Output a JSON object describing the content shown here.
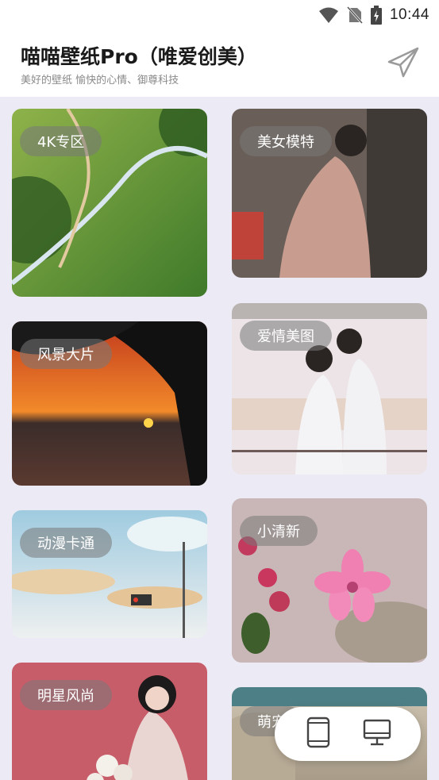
{
  "status_bar": {
    "time": "10:44",
    "icons": [
      "wifi-icon",
      "no-sim-icon",
      "battery-charging-icon"
    ]
  },
  "header": {
    "title": "喵喵壁纸Pro（唯爱创美）",
    "subtitle": "美好的壁纸 愉快的心情、御尊科技",
    "share_icon": "paper-plane-icon"
  },
  "categories": [
    {
      "label": "4K专区"
    },
    {
      "label": "美女模特"
    },
    {
      "label": "风景大片"
    },
    {
      "label": "爱情美图"
    },
    {
      "label": "动漫卡通"
    },
    {
      "label": "小清新"
    },
    {
      "label": "明星风尚"
    },
    {
      "label": "萌宠"
    }
  ],
  "switcher": {
    "items": [
      "phone-icon",
      "desktop-monitor-icon"
    ]
  },
  "colors": {
    "background": "#ecebf5",
    "header": "#ffffff",
    "pill": "rgba(120,120,120,0.55)"
  }
}
